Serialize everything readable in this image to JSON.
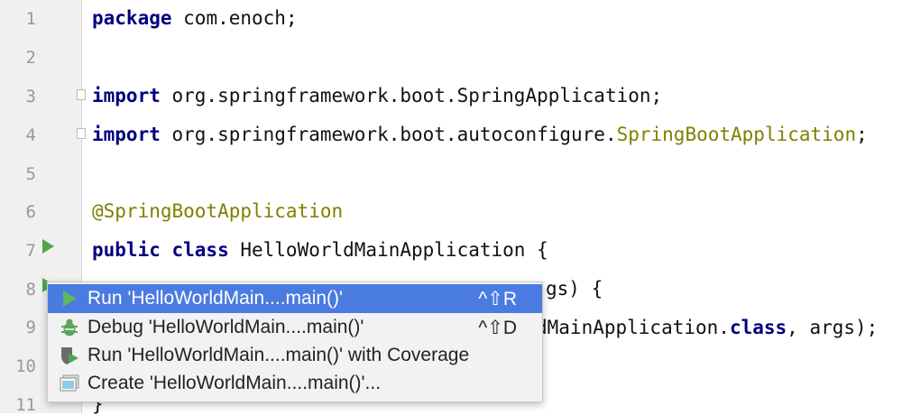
{
  "editor": {
    "line_numbers": [
      "1",
      "2",
      "3",
      "4",
      "5",
      "6",
      "7",
      "8",
      "9",
      "10",
      "11"
    ],
    "lines": {
      "l1_kw": "package",
      "l1_rest": " com.enoch;",
      "l3_kw": "import",
      "l3_rest": " org.springframework.boot.SpringApplication;",
      "l4_kw": "import",
      "l4_rest": " org.springframework.boot.autoconfigure.",
      "l4_ann": "SpringBootApplication",
      "l4_end": ";",
      "l6_ann": "@SpringBootApplication",
      "l7_kw": "public class",
      "l7_rest": " HelloWorldMainApplication {",
      "l8_tail": "gs) {",
      "l9_tail": "dMainApplication.",
      "l9_kw": "class",
      "l9_end": ", args);",
      "l11": "}"
    }
  },
  "context_menu": {
    "items": [
      {
        "label": "Run 'HelloWorldMain....main()'",
        "shortcut": "^⇧R",
        "icon": "run-icon",
        "selected": true
      },
      {
        "label": "Debug 'HelloWorldMain....main()'",
        "shortcut": "^⇧D",
        "icon": "debug-icon"
      },
      {
        "label": "Run 'HelloWorldMain....main()' with Coverage",
        "shortcut": "",
        "icon": "coverage-icon"
      },
      {
        "label": "Create 'HelloWorldMain....main()'...",
        "shortcut": "",
        "icon": "create-config-icon"
      }
    ]
  },
  "colors": {
    "keyword": "#000080",
    "annotation": "#808000",
    "selection": "#4a7be0",
    "run_green": "#4fa54f"
  }
}
